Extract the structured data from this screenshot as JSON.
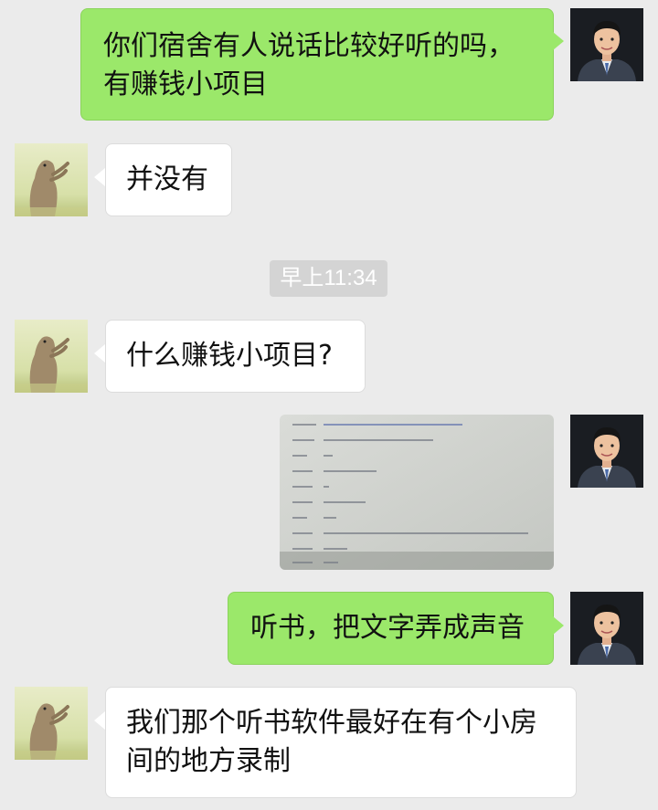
{
  "messages": [
    {
      "sender": "me",
      "text_lines": [
        "你们宿舍有人说话比较好听的吗，",
        "有赚钱小项目"
      ]
    },
    {
      "sender": "other",
      "text": "并没有"
    },
    {
      "timestamp": "早上11:34"
    },
    {
      "sender": "other",
      "text": "什么赚钱小项目?"
    },
    {
      "sender": "me",
      "type": "image"
    },
    {
      "sender": "me",
      "text": "听书，把文字弄成声音"
    },
    {
      "sender": "other",
      "text_lines": [
        "我们那个听书软件最好在有个小房",
        "间的地方录制"
      ]
    }
  ],
  "colors": {
    "background": "#ebebeb",
    "my_bubble": "#9be86a",
    "other_bubble": "#ffffff",
    "timestamp_bg": "#d4d4d4"
  },
  "icons": {
    "my_avatar": "man-portrait-avatar",
    "other_avatar": "prairie-dog-avatar"
  }
}
